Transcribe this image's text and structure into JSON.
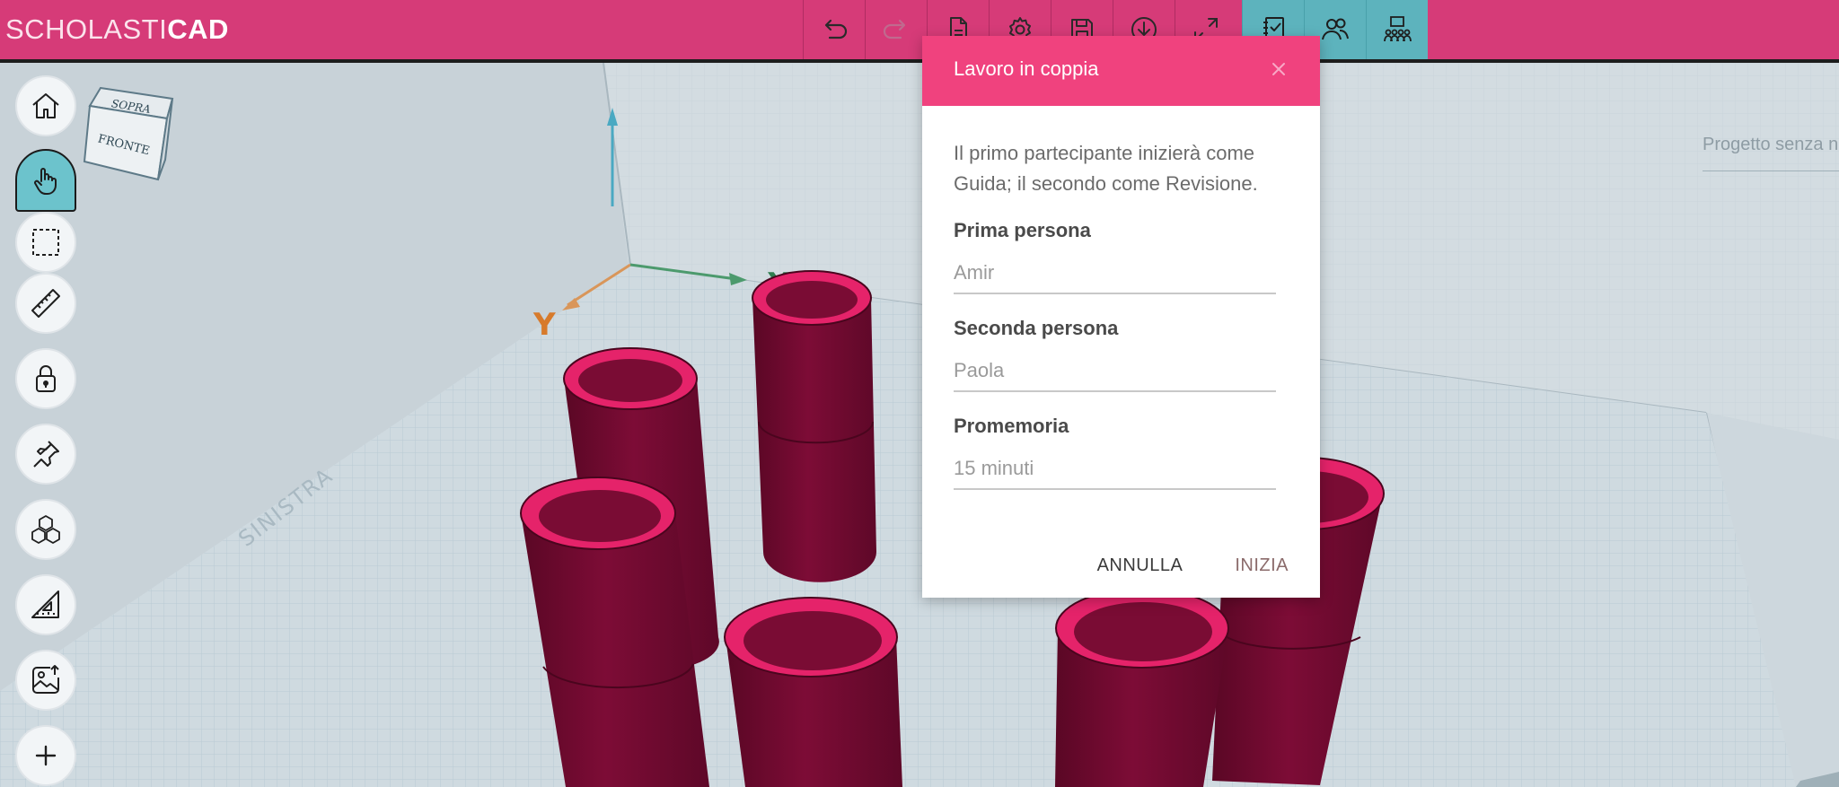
{
  "app": {
    "logo_light": "SCHOLASTI",
    "logo_bold": "CAD",
    "project_placeholder": "Progetto senza nome"
  },
  "toolbar": {
    "buttons": [
      {
        "name": "undo-icon"
      },
      {
        "name": "redo-icon"
      },
      {
        "name": "new-file-icon"
      },
      {
        "name": "settings-icon"
      },
      {
        "name": "save-icon"
      },
      {
        "name": "download-icon"
      },
      {
        "name": "fullscreen-icon"
      },
      {
        "name": "notebook-icon"
      },
      {
        "name": "pair-users-icon"
      },
      {
        "name": "classroom-icon"
      }
    ]
  },
  "left_tools": [
    {
      "name": "home-icon"
    },
    {
      "name": "pan-hand-icon"
    },
    {
      "name": "select-box-icon"
    },
    {
      "name": "ruler-icon"
    },
    {
      "name": "lock-icon"
    },
    {
      "name": "pin-icon"
    },
    {
      "name": "blocks-icon"
    },
    {
      "name": "set-square-icon"
    },
    {
      "name": "image-upload-icon"
    },
    {
      "name": "add-icon"
    }
  ],
  "viewcube": {
    "top": "SOPRA",
    "front": "FRONTE"
  },
  "scene": {
    "side_label": "SINISTRA",
    "axis_x": "X",
    "axis_y": "Y"
  },
  "dialog": {
    "title": "Lavoro in coppia",
    "description": "Il primo partecipante inizierà come Guida; il secondo come Revisione.",
    "fields": [
      {
        "label": "Prima persona",
        "placeholder": "Amir"
      },
      {
        "label": "Seconda persona",
        "placeholder": "Paola"
      },
      {
        "label": "Promemoria",
        "placeholder": "15 minuti"
      }
    ],
    "cancel_label": "ANNULLA",
    "start_label": "INIZIA"
  },
  "colors": {
    "brand": "#d63b78",
    "accent": "#5db3bd",
    "dialog_header": "#f0427e",
    "cylinder": "#7a0c34"
  }
}
